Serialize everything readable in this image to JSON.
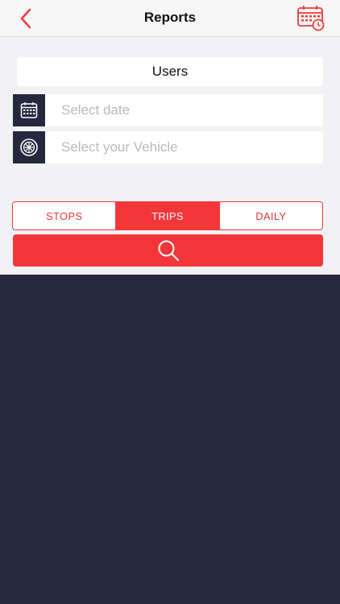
{
  "header": {
    "title": "Reports",
    "back_icon": "chevron-left-icon",
    "calendar_icon": "calendar-clock-icon"
  },
  "filters": {
    "users_label": "Users",
    "date_placeholder": "Select date",
    "vehicle_placeholder": "Select your Vehicle"
  },
  "report_tabs": [
    {
      "label": "STOPS",
      "active": false
    },
    {
      "label": "TRIPS",
      "active": true
    },
    {
      "label": "DAILY",
      "active": false
    }
  ],
  "search": {
    "icon": "search-icon"
  },
  "colors": {
    "accent": "#f3363a",
    "dark_bg": "#262840",
    "light_bg": "#f2f2f4"
  }
}
